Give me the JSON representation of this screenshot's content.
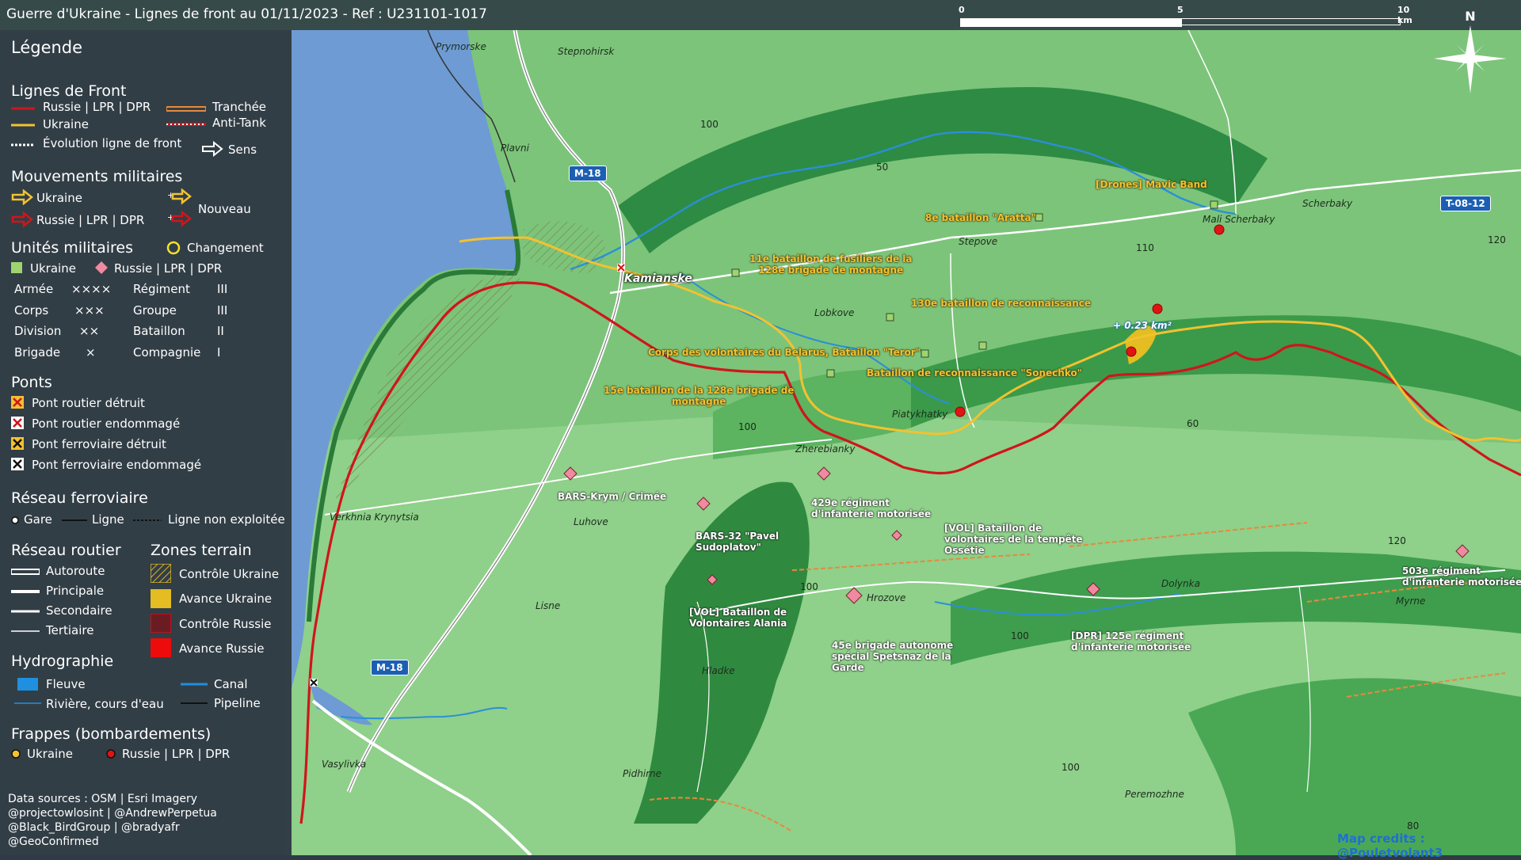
{
  "header": {
    "title": "Guerre d'Ukraine - Lignes de front au 01/11/2023 - Ref : U231101-1017",
    "scale_labels": [
      "0",
      "5",
      "10 km"
    ],
    "north_label": "N"
  },
  "legend": {
    "title": "Légende",
    "front": {
      "heading": "Lignes de Front",
      "russia": "Russie | LPR | DPR",
      "ukraine": "Ukraine",
      "evolution": "Évolution ligne de front",
      "trench": "Tranchée",
      "antitank": "Anti-Tank",
      "direction": "Sens"
    },
    "movements": {
      "heading": "Mouvements militaires",
      "ukraine": "Ukraine",
      "russia": "Russie | LPR | DPR",
      "new": "Nouveau"
    },
    "units": {
      "heading": "Unités militaires",
      "change": "Changement",
      "ukraine": "Ukraine",
      "russia": "Russie | LPR | DPR",
      "rows": [
        {
          "left": "Armée",
          "left_sym": "××××",
          "right": "Régiment",
          "right_sym": "III"
        },
        {
          "left": "Corps",
          "left_sym": "×××",
          "right": "Groupe",
          "right_sym": "III"
        },
        {
          "left": "Division",
          "left_sym": "××",
          "right": "Bataillon",
          "right_sym": "II"
        },
        {
          "left": "Brigade",
          "left_sym": "×",
          "right": "Compagnie",
          "right_sym": "I"
        }
      ]
    },
    "bridges": {
      "heading": "Ponts",
      "items": [
        "Pont routier détruit",
        "Pont routier endommagé",
        "Pont ferroviaire détruit",
        "Pont ferroviaire endommagé"
      ]
    },
    "rail": {
      "heading": "Réseau ferroviaire",
      "station": "Gare",
      "line": "Ligne",
      "unused": "Ligne non exploitée"
    },
    "roads": {
      "heading": "Réseau routier",
      "items": [
        "Autoroute",
        "Principale",
        "Secondaire",
        "Tertiaire"
      ]
    },
    "zones": {
      "heading": "Zones terrain",
      "items": [
        "Contrôle Ukraine",
        "Avance Ukraine",
        "Contrôle Russie",
        "Avance Russie"
      ]
    },
    "hydro": {
      "heading": "Hydrographie",
      "river_big": "Fleuve",
      "river": "Rivière, cours d'eau",
      "canal": "Canal",
      "pipeline": "Pipeline"
    },
    "strikes": {
      "heading": "Frappes (bombardements)",
      "ukraine": "Ukraine",
      "russia": "Russie | LPR | DPR"
    },
    "credits": [
      "Data sources : OSM | Esri Imagery",
      "@projectowlosint | @AndrewPerpetua",
      "@Black_BirdGroup | @bradyafr",
      "@GeoConfirmed"
    ]
  },
  "map": {
    "places": {
      "prymorske": "Prymorske",
      "stepnohirsk": "Stepnohirsk",
      "plavni": "Plavni",
      "kamianske": "Kamianske",
      "lobkove": "Lobkove",
      "stepove": "Stepove",
      "mali_scherbaky": "Mali Scherbaky",
      "scherbaky": "Scherbaky",
      "piatykhatky": "Piatykhatky",
      "zherebianky": "Zherebianky",
      "verkhnia": "Verkhnia Krynytsia",
      "luhove": "Luhove",
      "lisne": "Lisne",
      "hrozove": "Hrozove",
      "dolynka": "Dolynka",
      "myrne": "Myrne",
      "hladke": "Hladke",
      "vasylivka": "Vasylivka",
      "pidhirne": "Pidhirne",
      "peremozhne": "Peremozhne"
    },
    "roads": {
      "m18_top": "M-18",
      "m18_bottom": "M-18",
      "t0812": "T-08-12"
    },
    "elevations": [
      "100",
      "50",
      "110",
      "120",
      "60",
      "100",
      "100",
      "100",
      "120",
      "100",
      "80"
    ],
    "ukraine_units": {
      "mavic": "[Drones] Mavic Band",
      "aratta": "8e bataillon \"Aratta\"",
      "b11": [
        "11e bataillon de fusiliers de la",
        "128e brigade de montagne"
      ],
      "b130": "130e bataillon de reconnaissance",
      "belarus": "Corps des volontaires du Belarus, Bataillon \"Teror\"",
      "sonechko": "Bataillon de reconnaissance \"Sonechko\"",
      "b15": [
        "15e bataillon de la 128e brigade de",
        "montagne"
      ]
    },
    "russia_units": {
      "bars_krym": "BARS-Krym / Crimée",
      "bars32": [
        "BARS-32 \"Pavel",
        "Sudoplatov\""
      ],
      "r429": [
        "429e régiment",
        "d'infanterie motorisée"
      ],
      "vol_ossetie": [
        "[VOL] Bataillon de",
        "volontaires de la tempête",
        "Ossétie"
      ],
      "vol_alania": [
        "[VOL] Bataillon de",
        "Volontaires Alania"
      ],
      "b45": [
        "45e brigade autonome",
        "spécial Spetsnaz de la",
        "Garde"
      ],
      "r125": [
        "[DPR] 125e régiment",
        "d'infanterie motorisée"
      ],
      "r503": [
        "503e régiment",
        "d'infanterie motorisée"
      ]
    },
    "gain_label": "+ 0.23 km²",
    "credit": "Map credits : @Pouletvolant3"
  },
  "colors": {
    "russia_line": "#d0151b",
    "ukraine_line": "#f2c230",
    "water": "#6e9bd3",
    "land_light": "#9fd89a",
    "land_dark": "#2f8a3f",
    "legend_bg": "#2c3442"
  }
}
